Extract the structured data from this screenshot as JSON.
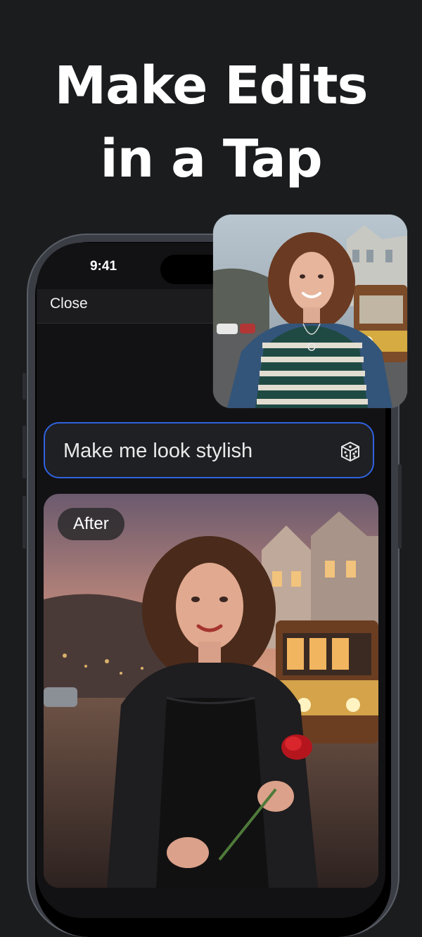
{
  "headline": {
    "line1": "Make Edits",
    "line2": "in a Tap"
  },
  "status_bar": {
    "time": "9:41"
  },
  "nav": {
    "close_label": "Close"
  },
  "prompt": {
    "text": "Make me look stylish",
    "icon": "dice-icon"
  },
  "after_photo": {
    "badge": "After",
    "description_icon": "woman-stylish-photo"
  },
  "before_photo": {
    "description_icon": "woman-casual-photo"
  },
  "colors": {
    "background": "#1b1c1e",
    "prompt_border": "#2f62e0",
    "screen": "#121214"
  }
}
